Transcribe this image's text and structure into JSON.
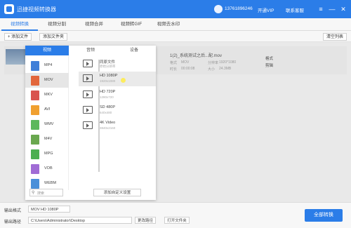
{
  "app": {
    "title": "迅捷视频转换器",
    "user_phone": "13761896246",
    "vip_label": "开通VIP",
    "service_label": "联系客服"
  },
  "window": {
    "menu_icon": "≡",
    "minimize_icon": "—",
    "close_icon": "✕"
  },
  "tabs": [
    {
      "label": "视频转换",
      "active": true
    },
    {
      "label": "视频分割",
      "active": false
    },
    {
      "label": "视频合并",
      "active": false
    },
    {
      "label": "视频转GIF",
      "active": false
    },
    {
      "label": "视频去水印",
      "active": false
    }
  ],
  "toolbar": {
    "add_file": "+ 添加文件",
    "add_folder": "添加文件夹",
    "clear_list": "清空列表"
  },
  "file": {
    "name": "1(2)_系统测试之后...配.mov",
    "format_key": "格式",
    "format_value": "MOV",
    "resolution_key": "分辨率",
    "resolution_value": "1920*1080",
    "duration_key": "时长",
    "duration_value": "00:00:08",
    "size_key": "大小",
    "size_value": "24.3MB",
    "action_edit": "格式",
    "action_cut": "剪辑"
  },
  "popup": {
    "tabs": [
      {
        "label": "视频",
        "active": true
      },
      {
        "label": "音频",
        "active": false
      },
      {
        "label": "设备",
        "active": false
      }
    ],
    "formats": [
      {
        "label": "MP4",
        "color": "#3f7fd8",
        "selected": false
      },
      {
        "label": "MOV",
        "color": "#e2663b",
        "selected": true
      },
      {
        "label": "MKV",
        "color": "#d9534f",
        "selected": false
      },
      {
        "label": "AVI",
        "color": "#f0a030",
        "selected": false
      },
      {
        "label": "WMV",
        "color": "#5cb85c",
        "selected": false
      },
      {
        "label": "M4V",
        "color": "#6aa84f",
        "selected": false
      },
      {
        "label": "MPG",
        "color": "#4caf50",
        "selected": false
      },
      {
        "label": "VOB",
        "color": "#a06cd5",
        "selected": false
      },
      {
        "label": "WEBM",
        "color": "#4a90d9",
        "selected": false
      }
    ],
    "options": [
      {
        "title": "同原文件",
        "sub": "原始分辨率",
        "hover": false
      },
      {
        "title": "HD 1080P",
        "sub": "1920x1080",
        "hover": true
      },
      {
        "title": "HD 720P",
        "sub": "1280x720",
        "hover": false
      },
      {
        "title": "SD 480P",
        "sub": "640x480",
        "hover": false
      },
      {
        "title": "4K Video",
        "sub": "3840x2160",
        "hover": false
      }
    ],
    "search_placeholder": "搜索",
    "custom_button": "添加自定义设置"
  },
  "bottom": {
    "output_format_label": "输出格式",
    "output_format_value": "MOV  HD 1080P",
    "output_path_label": "输出路径",
    "output_path_value": "C:\\Users\\Administrator\\Desktop",
    "change_path_button": "更改路径",
    "open_folder_button": "打开文件夹",
    "convert_all_button": "全部转换"
  },
  "colors": {
    "accent": "#2b7de8"
  }
}
